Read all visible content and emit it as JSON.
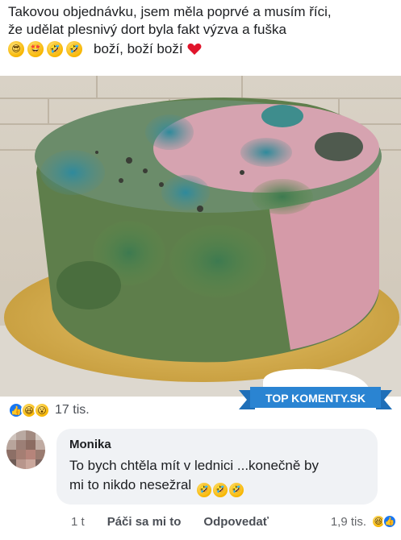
{
  "post": {
    "line1": "Takovou objednávku, jsem měla poprvé a musím říci,",
    "line2": "že udělat plesnivý dort byla fakt výzva a fuška",
    "line3_text": "boží, boží boží",
    "emojis": [
      "sunglasses-emoji",
      "star-eyes-emoji",
      "laughing-emoji",
      "laughing-emoji",
      "red-heart"
    ]
  },
  "badge": {
    "text": "TOP KOMENTY.SK"
  },
  "reactions": {
    "count": "17 tis.",
    "icons": [
      "like",
      "haha",
      "wow"
    ]
  },
  "comment": {
    "author": "Monika",
    "text_line1": "To bych chtěla mít v lednici ...konečně by",
    "text_line2": "mi to nikdo nesežral",
    "time": "1 t",
    "like_label": "Páči sa mi to",
    "reply_label": "Odpovedať",
    "reaction_count": "1,9 tis.",
    "reaction_icons": [
      "haha",
      "like"
    ]
  }
}
